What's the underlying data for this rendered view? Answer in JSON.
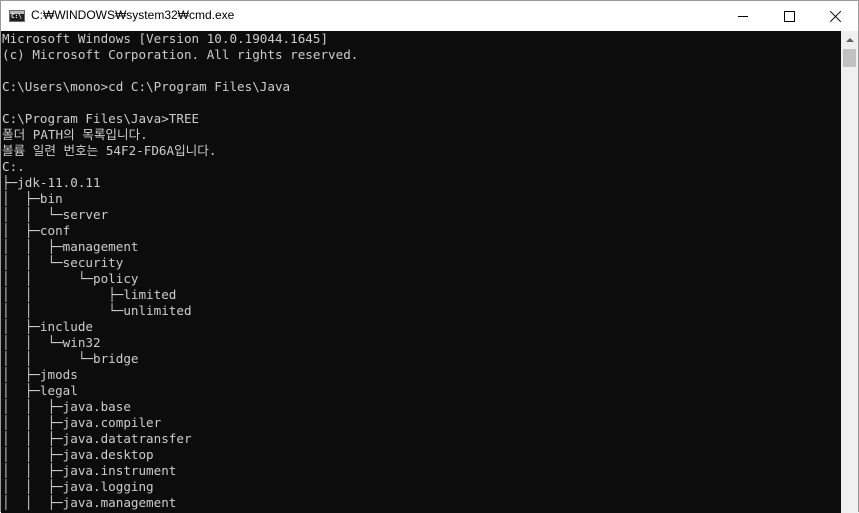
{
  "window": {
    "title": "C:₩WINDOWS₩system32₩cmd.exe",
    "icon": "cmd-icon",
    "controls": {
      "minimize": "minimize-icon",
      "maximize": "maximize-icon",
      "close": "close-icon"
    }
  },
  "console": {
    "lines": [
      "Microsoft Windows [Version 10.0.19044.1645]",
      "(c) Microsoft Corporation. All rights reserved.",
      "",
      "C:\\Users\\mono>cd C:\\Program Files\\Java",
      "",
      "C:\\Program Files\\Java>TREE",
      "폴더 PATH의 목록입니다.",
      "볼륨 일련 번호는 54F2-FD6A입니다.",
      "C:.",
      "├─jdk-11.0.11",
      "│  ├─bin",
      "│  │  └─server",
      "│  ├─conf",
      "│  │  ├─management",
      "│  │  └─security",
      "│  │      └─policy",
      "│  │          ├─limited",
      "│  │          └─unlimited",
      "│  ├─include",
      "│  │  └─win32",
      "│  │      └─bridge",
      "│  ├─jmods",
      "│  ├─legal",
      "│  │  ├─java.base",
      "│  │  ├─java.compiler",
      "│  │  ├─java.datatransfer",
      "│  │  ├─java.desktop",
      "│  │  ├─java.instrument",
      "│  │  ├─java.logging",
      "│  │  ├─java.management"
    ]
  },
  "colors": {
    "console_bg": "#0c0c0c",
    "console_fg": "#cccccc",
    "scrollbar": "#f0f0f0"
  }
}
